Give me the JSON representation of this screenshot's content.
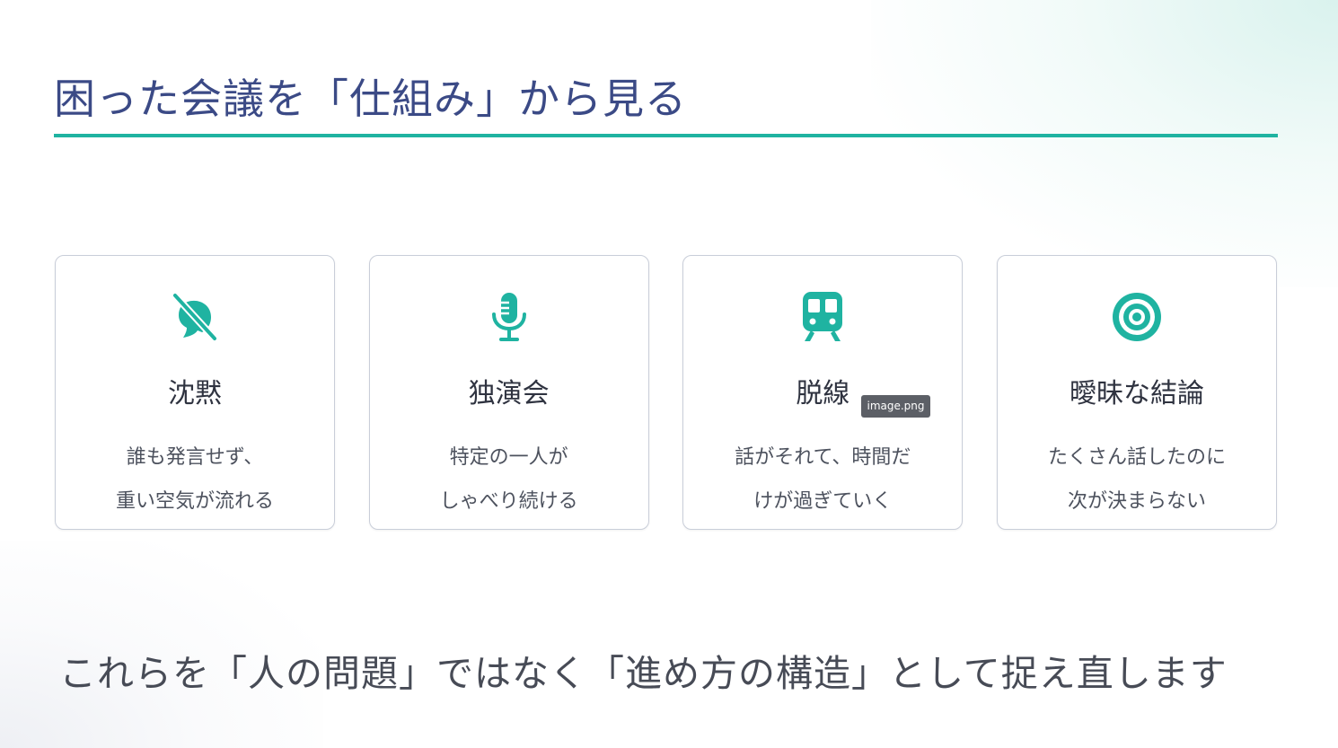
{
  "slide": {
    "title": "困った会議を「仕組み」から見る",
    "footer": "これらを「人の問題」ではなく「進め方の構造」として捉え直します"
  },
  "colors": {
    "accent": "#1fb3a1",
    "title": "#3b4a86",
    "icon": "#1fb3a1"
  },
  "cards": [
    {
      "icon": "mute-icon",
      "title": "沈黙",
      "lines": [
        "誰も発言せず、",
        "重い空気が流れる"
      ]
    },
    {
      "icon": "microphone-icon",
      "title": "独演会",
      "lines": [
        "特定の一人が",
        "しゃべり続ける"
      ]
    },
    {
      "icon": "train-icon",
      "title": "脱線",
      "lines": [
        "話がそれて、時間だ",
        "けが過ぎていく"
      ]
    },
    {
      "icon": "target-icon",
      "title": "曖昧な結論",
      "lines": [
        "たくさん話したのに",
        "次が決まらない"
      ]
    }
  ],
  "tooltip": {
    "text": "image.png"
  }
}
